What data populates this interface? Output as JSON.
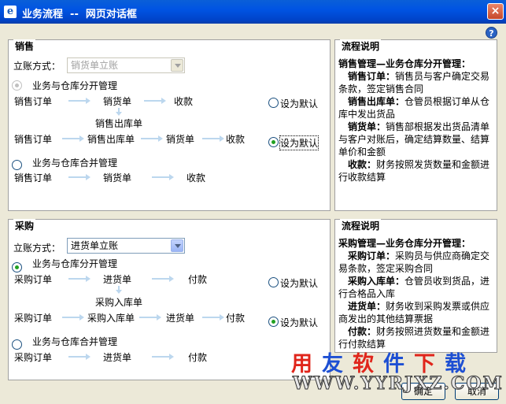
{
  "window": {
    "title": "业务流程  --  网页对话框",
    "icon": "ie-icon",
    "close_label": "×"
  },
  "help_label": "?",
  "sales": {
    "title": "销售",
    "account_label": "立账方式：",
    "account_value": "销货单立账",
    "option_separate": "业务与仓库分开管理",
    "option_merged": "业务与仓库合并管理",
    "flow1": [
      "销售订单",
      "销货单",
      "收款"
    ],
    "flow_branch_label": "销售出库单",
    "flow2": [
      "销售订单",
      "销售出库单",
      "销货单",
      "收款"
    ],
    "flow3": [
      "销售订单",
      "销货单",
      "收款"
    ],
    "default_label_1": "设为默认",
    "default_label_2": "设为默认"
  },
  "sales_desc": {
    "title": "流程说明",
    "heading": "销售管理—业务仓库分开管理：",
    "items": [
      {
        "term": "销售订单：",
        "text": "销售员与客户确定交易条款，签定销售合同"
      },
      {
        "term": "销售出库单：",
        "text": "仓管员根据订单从仓库中发出货品"
      },
      {
        "term": "销货单：",
        "text": "销售部根据发出货品清单与客户对账后，确定结算数量、结算单价和金额"
      },
      {
        "term": "收款：",
        "text": "财务按照发货数量和金额进行收款结算"
      }
    ]
  },
  "purchase": {
    "title": "采购",
    "account_label": "立账方式：",
    "account_value": "进货单立账",
    "option_separate": "业务与仓库分开管理",
    "option_merged": "业务与仓库合并管理",
    "flow1": [
      "采购订单",
      "进货单",
      "付款"
    ],
    "flow_branch_label": "采购入库单",
    "flow2": [
      "采购订单",
      "采购入库单",
      "进货单",
      "付款"
    ],
    "flow3": [
      "采购订单",
      "进货单",
      "付款"
    ],
    "default_label_1": "设为默认",
    "default_label_2": "设为默认"
  },
  "purchase_desc": {
    "title": "流程说明",
    "heading": "采购管理—业务仓库分开管理：",
    "items": [
      {
        "term": "采购订单：",
        "text": "采购员与供应商确定交易条款，签定采购合同"
      },
      {
        "term": "采购入库单：",
        "text": "仓管员收到货品，进行合格品入库"
      },
      {
        "term": "进货单：",
        "text": "财务收到采购发票或供应商发出的其他结算票据"
      },
      {
        "term": "付款：",
        "text": "财务按照进货数量和金额进行付款结算"
      }
    ]
  },
  "buttons": {
    "ok": "确定",
    "cancel": "取消"
  },
  "watermark": {
    "chars": [
      "用",
      "友",
      "软",
      "件",
      "下",
      "载"
    ],
    "colors": [
      "#e0251b",
      "#1d4fd3",
      "#e0251b",
      "#1d4fd3",
      "#e0251b",
      "#1d4fd3"
    ],
    "url": "WWW.YYRJXZ.COM"
  }
}
